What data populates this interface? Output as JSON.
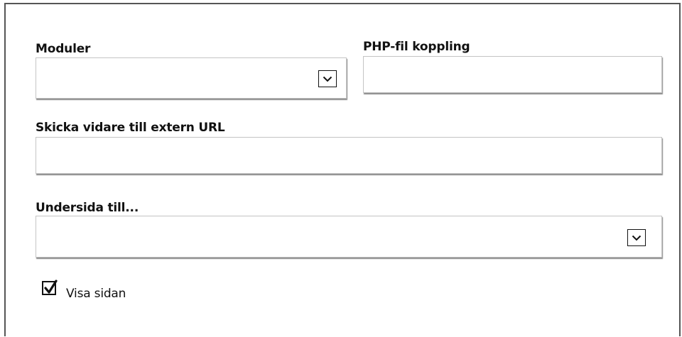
{
  "form": {
    "moduler": {
      "label": "Moduler",
      "selected": ""
    },
    "php_file": {
      "label": "PHP-fil koppling",
      "value": ""
    },
    "external_url": {
      "label": "Skicka vidare till extern URL",
      "value": ""
    },
    "parent_page": {
      "label": "Undersida till...",
      "selected": ""
    },
    "visible": {
      "label": "Visa sidan",
      "checked": true
    }
  },
  "icons": {
    "dropdown": "chevron-down-icon",
    "checkbox": "checkmark-icon"
  }
}
